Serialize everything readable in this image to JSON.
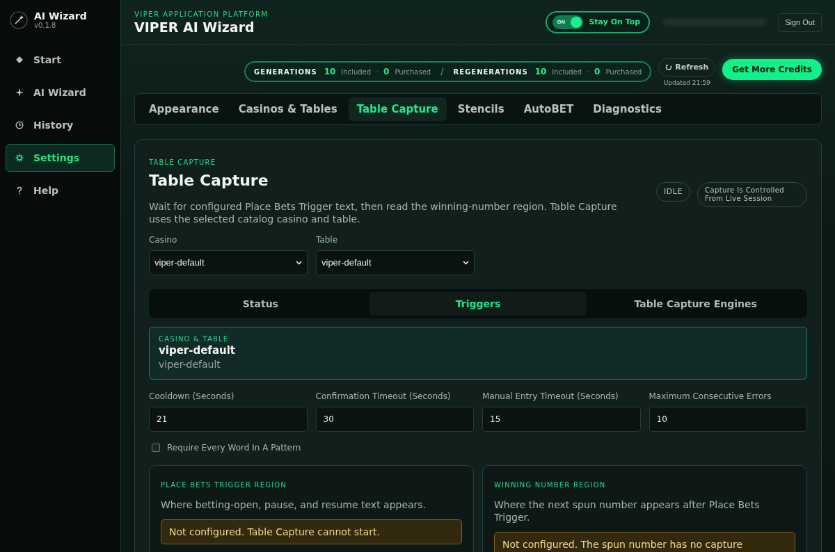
{
  "app": {
    "name": "AI Wizard",
    "version": "v0.1.8"
  },
  "sidebar": {
    "items": [
      {
        "label": "Start",
        "selected": false
      },
      {
        "label": "AI Wizard",
        "selected": false
      },
      {
        "label": "History",
        "selected": false
      },
      {
        "label": "Settings",
        "selected": true
      },
      {
        "label": "Help",
        "selected": false
      }
    ]
  },
  "header": {
    "eyebrow": "VIPER APPLICATION PLATFORM",
    "title": "VIPER AI Wizard",
    "stay_on_top": {
      "switch_text": "ON",
      "label": "Stay On Top",
      "on": true
    },
    "sign_out": "Sign Out"
  },
  "credits": {
    "groups": [
      {
        "label": "GENERATIONS",
        "included": "10",
        "included_label": "Included",
        "purchased": "0",
        "purchased_label": "Purchased"
      },
      {
        "label": "REGENERATIONS",
        "included": "10",
        "included_label": "Included",
        "purchased": "0",
        "purchased_label": "Purchased"
      }
    ],
    "separator": "/",
    "refresh": "Refresh",
    "updated": "Updated 21:59",
    "get_more": "Get More Credits"
  },
  "tabs": [
    {
      "label": "Appearance",
      "selected": false
    },
    {
      "label": "Casinos & Tables",
      "selected": false
    },
    {
      "label": "Table Capture",
      "selected": true
    },
    {
      "label": "Stencils",
      "selected": false
    },
    {
      "label": "AutoBET",
      "selected": false
    },
    {
      "label": "Diagnostics",
      "selected": false
    }
  ],
  "card": {
    "eyebrow": "TABLE CAPTURE",
    "title": "Table Capture",
    "description": "Wait for configured Place Bets Trigger text, then read the winning-number region. Table Capture uses the selected catalog casino and table.",
    "status_badge": "IDLE",
    "control_note": "Capture Is Controlled From Live Session",
    "selects": [
      {
        "label": "Casino",
        "value": "viper-default"
      },
      {
        "label": "Table",
        "value": "viper-default"
      }
    ],
    "subtabs": [
      {
        "label": "Status",
        "selected": false
      },
      {
        "label": "Triggers",
        "selected": true
      },
      {
        "label": "Table Capture Engines",
        "selected": false
      }
    ],
    "casino_table": {
      "eyebrow": "CASINO & TABLE",
      "name": "viper-default",
      "detail": "viper-default"
    },
    "fields": [
      {
        "label": "Cooldown (Seconds)",
        "value": "21"
      },
      {
        "label": "Confirmation Timeout (Seconds)",
        "value": "30"
      },
      {
        "label": "Manual Entry Timeout (Seconds)",
        "value": "15"
      },
      {
        "label": "Maximum Consecutive Errors",
        "value": "10"
      }
    ],
    "require_every_word": {
      "label": "Require Every Word In A Pattern",
      "checked": false
    },
    "regions": [
      {
        "eyebrow": "PLACE BETS TRIGGER REGION",
        "description": "Where betting-open, pause, and resume text appears.",
        "warning": "Not configured. Table Capture cannot start."
      },
      {
        "eyebrow": "WINNING NUMBER REGION",
        "description": "Where the next spun number appears after Place Bets Trigger.",
        "warning": "Not configured. The spun number has no capture"
      }
    ]
  }
}
